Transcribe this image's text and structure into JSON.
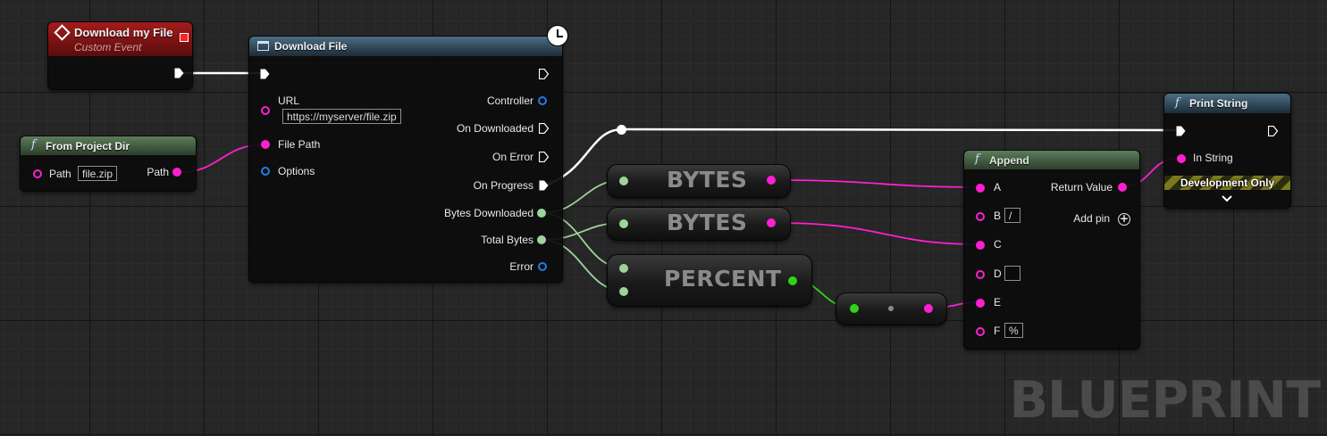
{
  "watermark": "BLUEPRINT",
  "nodes": {
    "event": {
      "title": "Download my File",
      "subtitle": "Custom Event"
    },
    "project_dir": {
      "title": "From Project Dir",
      "path_label": "Path",
      "path_value": "file.zip",
      "out_label": "Path"
    },
    "download": {
      "title": "Download File",
      "url_label": "URL",
      "url_value": "https://myserver/file.zip",
      "file_path_label": "File Path",
      "options_label": "Options",
      "outputs": [
        "Controller",
        "On Downloaded",
        "On Error",
        "On Progress",
        "Bytes Downloaded",
        "Total Bytes",
        "Error"
      ]
    },
    "bytes1": {
      "title": "BYTES"
    },
    "bytes2": {
      "title": "BYTES"
    },
    "percent": {
      "title": "PERCENT"
    },
    "append": {
      "title": "Append",
      "pins": [
        "A",
        "B",
        "C",
        "D",
        "E",
        "F"
      ],
      "b_value": "/",
      "d_value": "",
      "f_value": "%",
      "return_label": "Return Value",
      "add_pin_label": "Add pin"
    },
    "print": {
      "title": "Print String",
      "in_string_label": "In String",
      "dev_label": "Development Only"
    }
  },
  "colors": {
    "string": "#ff1fd2",
    "exec": "#ffffff",
    "int64": "#9ed39a",
    "float": "#2fd21a",
    "struct": "#1f7ee8",
    "event_header": "#8a1212",
    "function_header": "#3f5d3f",
    "latent_header": "#2f4a5e"
  }
}
